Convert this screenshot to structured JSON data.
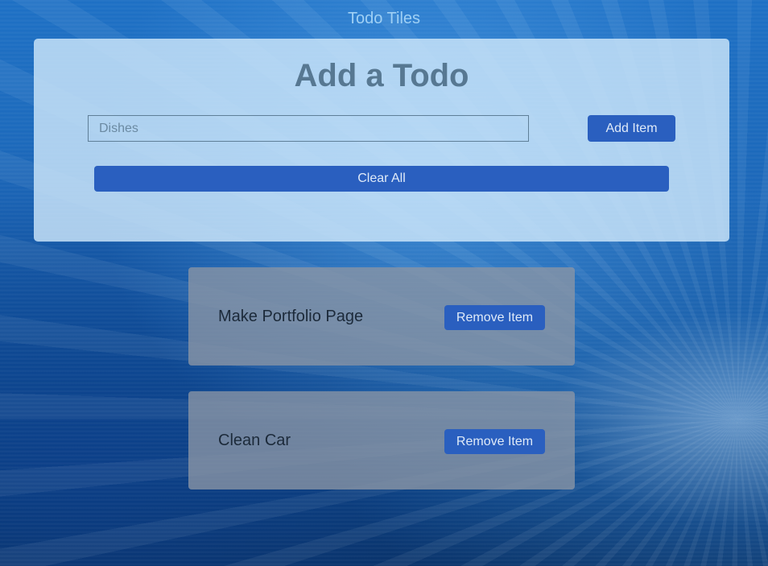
{
  "app": {
    "title": "Todo Tiles"
  },
  "add_panel": {
    "heading": "Add a Todo",
    "input_placeholder": "Dishes",
    "input_value": "",
    "add_button_label": "Add Item",
    "clear_button_label": "Clear All"
  },
  "todos": [
    {
      "text": "Make Portfolio Page",
      "remove_label": "Remove Item"
    },
    {
      "text": "Clean Car",
      "remove_label": "Remove Item"
    }
  ],
  "colors": {
    "accent_button": "#2a5fbf",
    "panel": "#cde6fa",
    "card": "#8c96a5",
    "heading": "#577892"
  }
}
